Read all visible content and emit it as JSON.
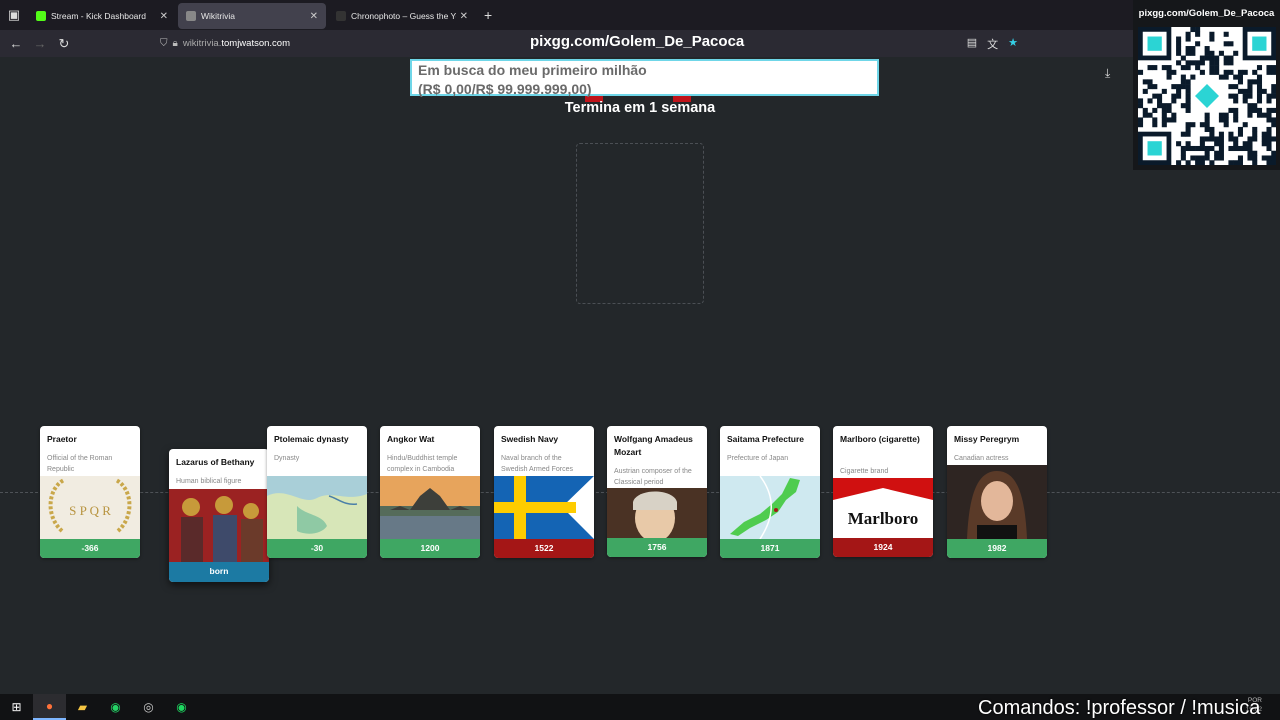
{
  "browser": {
    "tabs": [
      {
        "title": "Stream - Kick Dashboard",
        "favicon_color": "#53fc18",
        "active": false
      },
      {
        "title": "Wikitrivia",
        "favicon_color": "#888888",
        "active": true
      },
      {
        "title": "Chronophoto – Guess the Year",
        "favicon_color": "#333333",
        "active": false
      }
    ],
    "url_prefix": "wikitrivia.",
    "url_host": "tomjwatson.com"
  },
  "overlay": {
    "title": "pixgg.com/Golem_De_Pacoca",
    "qr_url": "pixgg.com/Golem_De_Pacoca",
    "donation_line1": "Em busca do meu primeiro milhão",
    "donation_line2": "(R$ 0,00/R$ 99.999.999,00)",
    "countdown": "Termina em 1 semana",
    "commands": "Comandos: !professor / !musica"
  },
  "game": {
    "active_card": {
      "title": "Lazarus of Bethany",
      "description": "Human biblical figure",
      "label": "born",
      "color": "#1c7aa3"
    },
    "cards": [
      {
        "title": "Praetor",
        "description": "Official of the Roman Republic",
        "year": "-366",
        "status": "correct"
      },
      {
        "title": "Ptolemaic dynasty",
        "description": "Dynasty",
        "year": "-30",
        "status": "correct"
      },
      {
        "title": "Angkor Wat",
        "description": "Hindu/Buddhist temple complex in Cambodia",
        "year": "1200",
        "status": "correct"
      },
      {
        "title": "Swedish Navy",
        "description": "Naval branch of the Swedish Armed Forces",
        "year": "1522",
        "status": "wrong"
      },
      {
        "title": "Wolfgang Amadeus Mozart",
        "description": "Austrian composer of the Classical period",
        "year": "1756",
        "status": "correct"
      },
      {
        "title": "Saitama Prefecture",
        "description": "Prefecture of Japan",
        "year": "1871",
        "status": "correct"
      },
      {
        "title": "Marlboro (cigarette)",
        "description": "Cigarette brand",
        "year": "1924",
        "status": "wrong"
      },
      {
        "title": "Missy Peregrym",
        "description": "Canadian actress",
        "year": "1982",
        "status": "correct"
      }
    ],
    "image_text": {
      "praetor": "S P Q R",
      "marlboro": "Marlboro"
    }
  },
  "colors": {
    "correct": "#3fa763",
    "wrong": "#a41616",
    "active": "#1c7aa3",
    "accent": "#6fd6e8"
  },
  "tray": {
    "line1": "POR",
    "line2": "19:02"
  }
}
